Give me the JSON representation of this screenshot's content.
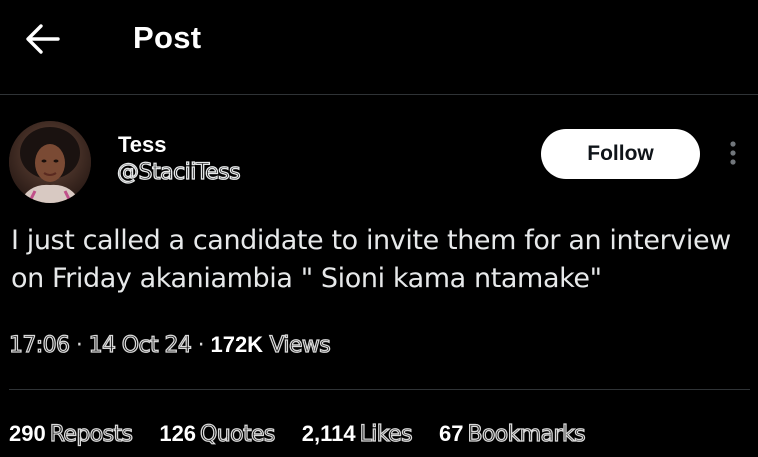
{
  "header": {
    "title": "Post"
  },
  "post": {
    "author": {
      "name": "Tess",
      "handle": "@StaciiTess"
    },
    "follow_label": "Follow",
    "text_line1": "I just called a candidate to invite them for an interview",
    "text_line2": "on Friday akaniambia \" Sioni kama ntamake\"",
    "time": "17:06",
    "date": "14 Oct 24",
    "views_count": "172K",
    "views_label": "Views",
    "separator": "·"
  },
  "stats": [
    {
      "count": "290",
      "label": "Reposts"
    },
    {
      "count": "126",
      "label": "Quotes"
    },
    {
      "count": "2,114",
      "label": "Likes"
    },
    {
      "count": "67",
      "label": "Bookmarks"
    }
  ],
  "colors": {
    "background": "#000000",
    "text": "#e7e9ea",
    "divider": "#2f3336",
    "button": "#ffffff"
  }
}
